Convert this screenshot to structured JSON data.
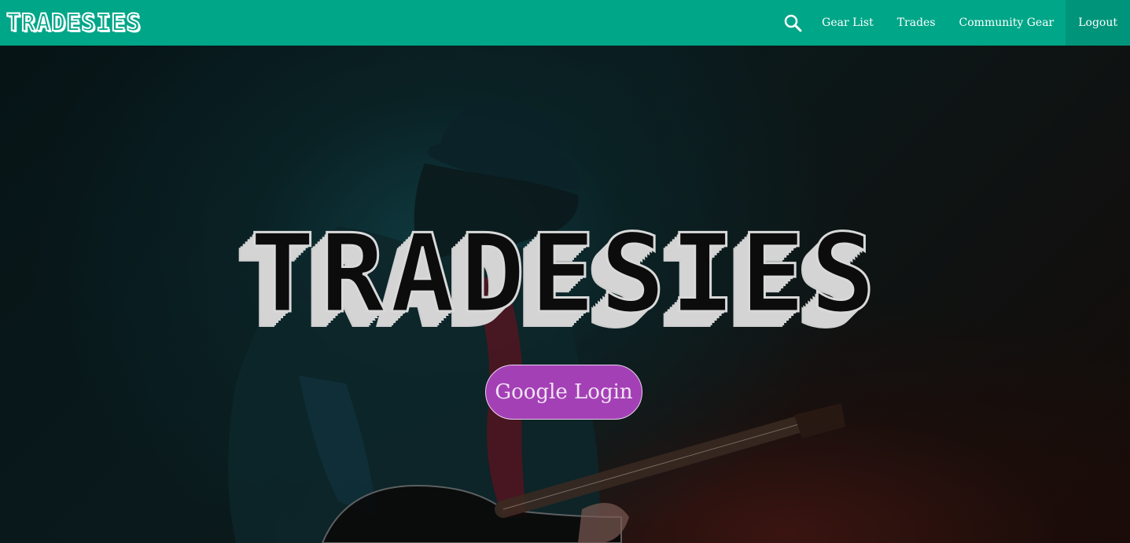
{
  "navbar": {
    "brand": "TRADESIES",
    "search_icon": "search-icon",
    "links": [
      "Gear List",
      "Trades",
      "Community Gear",
      "Logout"
    ]
  },
  "hero": {
    "title": "TRADESIES",
    "login_label": "Google Login"
  },
  "colors": {
    "navbar": "#00a688",
    "navbar_active": "#00957a",
    "login_button": "#a440b5"
  }
}
